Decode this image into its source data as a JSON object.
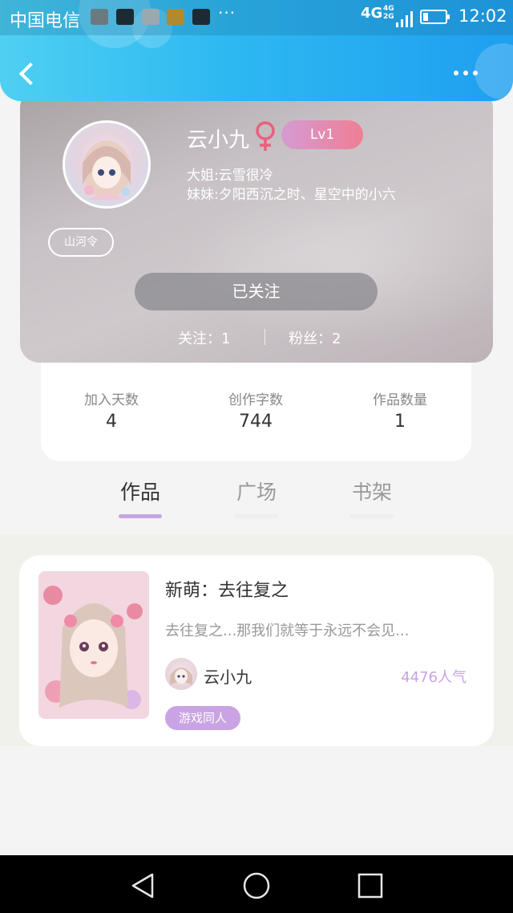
{
  "status_bar": {
    "carrier": "中国电信",
    "more": "···",
    "network": "4G",
    "network_small": "4G\n2G",
    "time": "12:02"
  },
  "header": {
    "back_icon": "back-arrow-icon",
    "more_icon": "more-dots-icon"
  },
  "profile": {
    "nickname": "云小九",
    "gender_icon": "female-icon",
    "level": "Lv1",
    "relation_1": "大姐:云雪很冷",
    "relation_2": "妹妹:夕阳西沉之时、星空中的小六",
    "tag": "山河令",
    "follow_button": "已关注",
    "following": "关注：1",
    "fans": "粉丝：2"
  },
  "stats": [
    {
      "label": "加入天数",
      "value": "4"
    },
    {
      "label": "创作字数",
      "value": "744"
    },
    {
      "label": "作品数量",
      "value": "1"
    }
  ],
  "tabs": [
    {
      "label": "作品",
      "active": true
    },
    {
      "label": "广场",
      "active": false
    },
    {
      "label": "书架",
      "active": false
    }
  ],
  "work": {
    "title": "新萌：去往复之",
    "excerpt": "去往复之...那我们就等于永远不会见...",
    "author": "云小九",
    "popularity": "4476人气",
    "tag": "游戏同人"
  },
  "colors": {
    "header_blue": "#2db8f1",
    "accent_purple": "#c9a3e3",
    "level_pink": "#ef7e94"
  },
  "nav": {
    "back_icon": "nav-back-icon",
    "home_icon": "nav-home-icon",
    "recent_icon": "nav-recent-icon"
  }
}
